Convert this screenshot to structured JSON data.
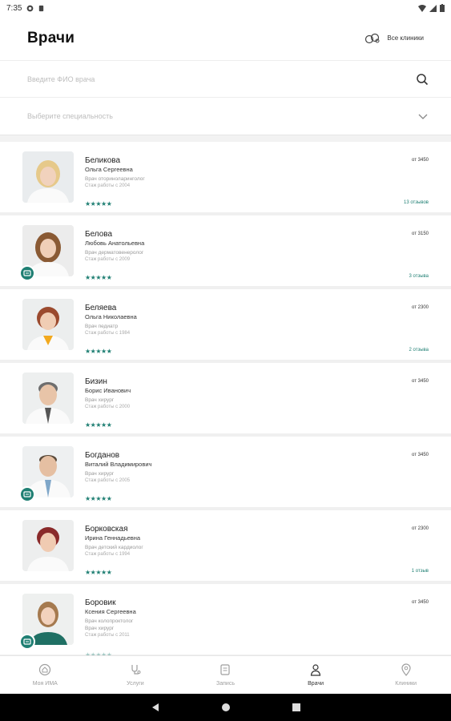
{
  "statusbar": {
    "time": "7:35"
  },
  "header": {
    "title": "Врачи",
    "all_clinics": "Все клиники"
  },
  "search": {
    "placeholder": "Введите ФИО врача"
  },
  "specialty": {
    "placeholder": "Выберите специальность"
  },
  "colors": {
    "accent": "#1f7f73"
  },
  "doctors": [
    {
      "surname": "Беликова",
      "given": "Ольга Сергеевна",
      "specialty": "Врач оториноларинголог",
      "experience": "Стаж работы с 2004",
      "price": "от 3450",
      "stars": "★★★★★",
      "reviews": "13 отзывов",
      "badge": false
    },
    {
      "surname": "Белова",
      "given": "Любовь Анатольевна",
      "specialty": "Врач дерматовенеролог",
      "experience": "Стаж работы с 2009",
      "price": "от 3150",
      "stars": "★★★★★",
      "reviews": "3 отзыва",
      "badge": true
    },
    {
      "surname": "Беляева",
      "given": "Ольга Николаевна",
      "specialty": "Врач педиатр",
      "experience": "Стаж работы с 1984",
      "price": "от 2300",
      "stars": "★★★★★",
      "reviews": "2 отзыва",
      "badge": false
    },
    {
      "surname": "Бизин",
      "given": "Борис Иванович",
      "specialty": "Врач хирург",
      "experience": "Стаж работы с 2000",
      "price": "от 3450",
      "stars": "★★★★★",
      "reviews": "",
      "badge": false
    },
    {
      "surname": "Богданов",
      "given": "Виталий Владимирович",
      "specialty": "Врач хирург",
      "experience": "Стаж работы с 2005",
      "price": "от 3450",
      "stars": "★★★★★",
      "reviews": "",
      "badge": true
    },
    {
      "surname": "Борковская",
      "given": "Ирина Геннадьевна",
      "specialty": "Врач детский кардиолог",
      "experience": "Стаж работы с 1994",
      "price": "от 2300",
      "stars": "★★★★★",
      "reviews": "1 отзыв",
      "badge": false
    },
    {
      "surname": "Боровик",
      "given": "Ксения Сергеевна",
      "specialty": "Врач колопроктолог",
      "specialty2": "Врач хирург",
      "experience": "Стаж работы с 2011",
      "price": "от 3450",
      "stars": "★★★★★",
      "reviews": "",
      "badge": true
    }
  ],
  "tabs": [
    {
      "label": "Моя ИМА",
      "icon": "home-icon"
    },
    {
      "label": "Услуги",
      "icon": "stethoscope-icon"
    },
    {
      "label": "Запись",
      "icon": "calendar-icon"
    },
    {
      "label": "Врачи",
      "icon": "doctor-icon",
      "active": true
    },
    {
      "label": "Клиники",
      "icon": "map-pin-icon"
    }
  ]
}
